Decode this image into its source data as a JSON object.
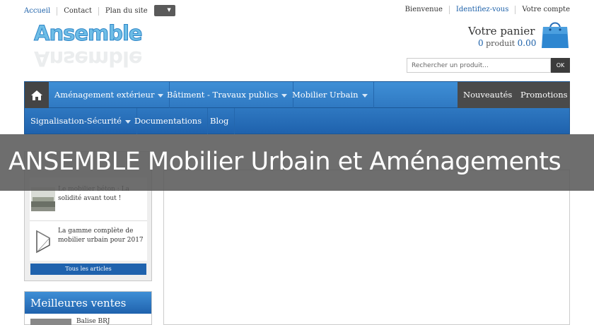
{
  "top_left": [
    "Accueil",
    "Contact",
    "Plan du site"
  ],
  "lang_select": "▼",
  "top_right": [
    "Bienvenue",
    "Identifiez-vous",
    "Votre compte"
  ],
  "logo_text": "Ansemble",
  "cart": {
    "title": "Votre panier",
    "count": "0",
    "count_label": "produit",
    "total": "0.00"
  },
  "search": {
    "placeholder": "Rechercher un produit...",
    "button": "OK"
  },
  "nav": {
    "row1": [
      "Aménagement extérieur",
      "Bâtiment - Travaux publics",
      "Mobilier Urbain"
    ],
    "row1_right": [
      "Nouveautés",
      "Promotions"
    ],
    "row2": [
      "Signalisation-Sécurité",
      "Documentations",
      "Blog"
    ]
  },
  "banner": "ANSEMBLE Mobilier Urbain et Aménagements",
  "articles": [
    {
      "text": "Le mobilier béton : La solidité avant tout !"
    },
    {
      "text": "La gamme complète de mobilier urbain pour 2017"
    }
  ],
  "all_articles": "Tous les articles",
  "best_sellers": {
    "title": "Meilleures ventes",
    "item": "Balise BRJ"
  },
  "colors": {
    "brand_blue": "#1f62ad",
    "link": "#1a5fa8",
    "banner": "#5a5a5a"
  }
}
